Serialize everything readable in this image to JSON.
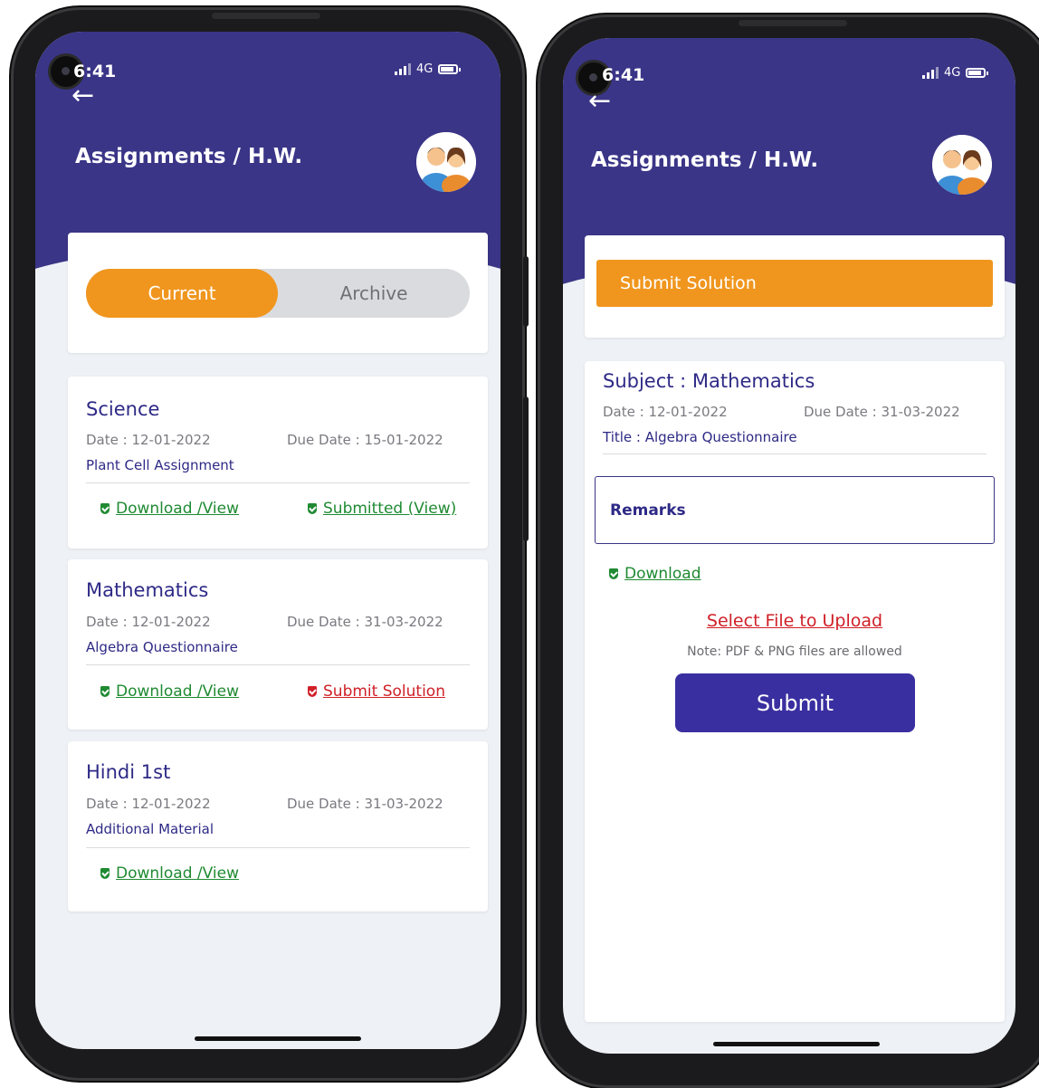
{
  "status_bar": {
    "time": "6:41",
    "network": "4G"
  },
  "header": {
    "title": "Assignments / H.W."
  },
  "tabs": {
    "current": "Current",
    "archive": "Archive"
  },
  "assignments": [
    {
      "subject": "Science",
      "date": "Date : 12-01-2022",
      "due": "Due Date : 15-01-2022",
      "title": "Plant Cell Assignment",
      "download": "Download /View",
      "action": "Submitted (View)"
    },
    {
      "subject": "Mathematics",
      "date": "Date : 12-01-2022",
      "due": "Due Date : 31-03-2022",
      "title": "Algebra Questionnaire",
      "download": "Download /View",
      "action": "Submit Solution"
    },
    {
      "subject": "Hindi 1st",
      "date": "Date : 12-01-2022",
      "due": "Due Date : 31-03-2022",
      "title": "Additional Material",
      "download": "Download /View"
    }
  ],
  "detail": {
    "heading": "Submit Solution",
    "subject": "Subject : Mathematics",
    "date": "Date : 12-01-2022",
    "due": "Due Date : 31-03-2022",
    "title": "Title : Algebra Questionnaire",
    "remarks": "Remarks",
    "download": "Download",
    "upload": "Select File to Upload",
    "note": "Note: PDF & PNG files are allowed",
    "submit": "Submit"
  },
  "colors": {
    "header": "#3a3587",
    "accent": "#f0961e",
    "link_green": "#1f8a32",
    "link_red": "#d02028",
    "submit": "#3a2fa0"
  },
  "icons": [
    "back-arrow-icon",
    "camera-icon",
    "signal-icon",
    "battery-icon",
    "avatar-icon",
    "shield-check-icon"
  ]
}
